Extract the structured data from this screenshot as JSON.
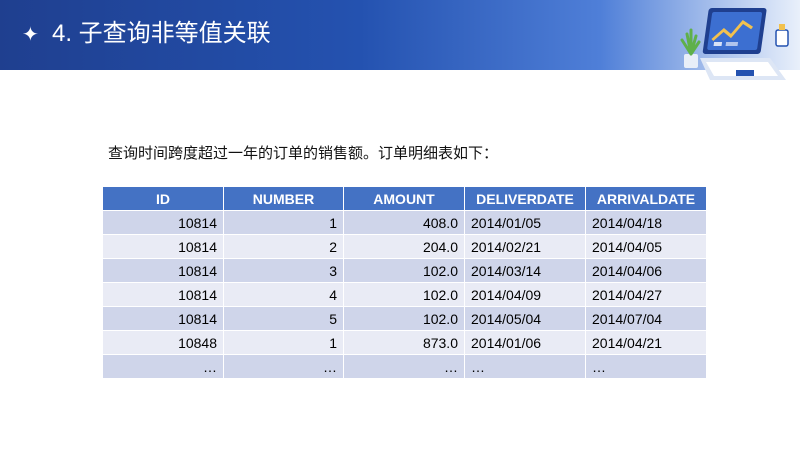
{
  "slide": {
    "bullet_glyph": "✦",
    "title": "4. 子查询非等值关联",
    "intro_text": "查询时间跨度超过一年的订单的销售额。订单明细表如下："
  },
  "table": {
    "columns": [
      "ID",
      "NUMBER",
      "AMOUNT",
      "DELIVERDATE",
      "ARRIVALDATE"
    ],
    "rows": [
      [
        "10814",
        "1",
        "408.0",
        "2014/01/05",
        "2014/04/18"
      ],
      [
        "10814",
        "2",
        "204.0",
        "2014/02/21",
        "2014/04/05"
      ],
      [
        "10814",
        "3",
        "102.0",
        "2014/03/14",
        "2014/04/06"
      ],
      [
        "10814",
        "4",
        "102.0",
        "2014/04/09",
        "2014/04/27"
      ],
      [
        "10814",
        "5",
        "102.0",
        "2014/05/04",
        "2014/07/04"
      ],
      [
        "10848",
        "1",
        "873.0",
        "2014/01/06",
        "2014/04/21"
      ],
      [
        "…",
        "…",
        "…",
        "…",
        "…"
      ]
    ]
  },
  "colors": {
    "header_start": "#1f3f8f",
    "table_header": "#4472c4",
    "row_odd": "#cfd5ea",
    "row_even": "#e9ebf5"
  },
  "icons": [
    "laptop-analytics-illustration",
    "plant-icon",
    "sparkle-bullet-icon"
  ]
}
